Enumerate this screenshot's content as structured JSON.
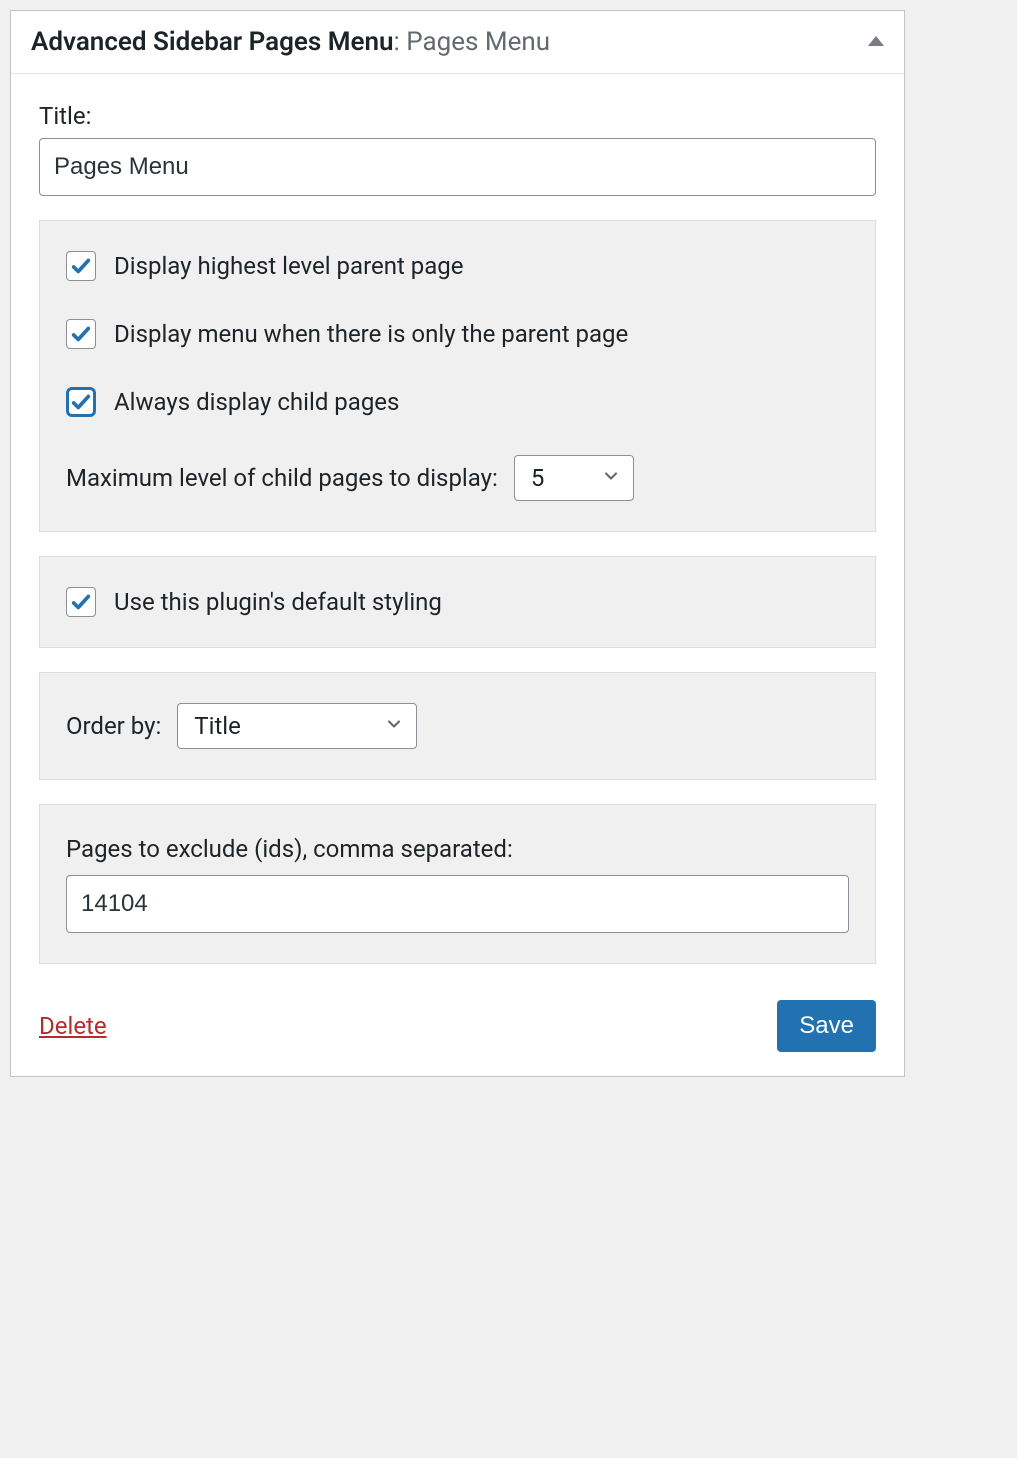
{
  "header": {
    "title": "Advanced Sidebar Pages Menu",
    "subtitle": "Pages Menu"
  },
  "title_field": {
    "label": "Title:",
    "value": "Pages Menu"
  },
  "display_options": {
    "highest_parent": {
      "label": "Display highest level parent page",
      "checked": true
    },
    "only_parent": {
      "label": "Display menu when there is only the parent page",
      "checked": true
    },
    "always_children": {
      "label": "Always display child pages",
      "checked": true
    },
    "max_level": {
      "label": "Maximum level of child pages to display:",
      "value": "5"
    }
  },
  "styling": {
    "default_styling": {
      "label": "Use this plugin's default styling",
      "checked": true
    }
  },
  "order": {
    "label": "Order by:",
    "value": "Title"
  },
  "exclude": {
    "label": "Pages to exclude (ids), comma separated:",
    "value": "14104"
  },
  "footer": {
    "delete_label": "Delete",
    "save_label": "Save"
  }
}
